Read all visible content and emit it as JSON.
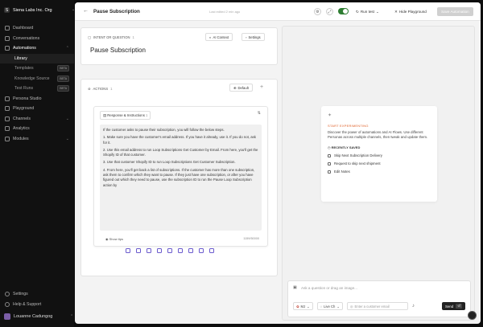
{
  "org": {
    "name": "Siena Labs Inc. Org"
  },
  "sidebar": {
    "items": [
      {
        "label": "Dashboard"
      },
      {
        "label": "Conversations"
      },
      {
        "label": "Automations"
      },
      {
        "label": "Library"
      },
      {
        "label": "Templates",
        "badge": "BETA"
      },
      {
        "label": "Knowledge Source",
        "badge": "BETA"
      },
      {
        "label": "Test Runs",
        "badge": "BETA"
      },
      {
        "label": "Persona Studio"
      },
      {
        "label": "Playground"
      },
      {
        "label": "Channels"
      },
      {
        "label": "Analytics"
      },
      {
        "label": "Modules"
      }
    ],
    "bottom": [
      {
        "label": "Settings"
      },
      {
        "label": "Help & Support"
      }
    ],
    "user": "Louanne Cadungog"
  },
  "header": {
    "title": "Pause Subscription",
    "edited": "Last edited 2 min ago",
    "run_test": "Run test",
    "hide_playground": "Hide Playground",
    "save": "Save Automation"
  },
  "intent": {
    "label": "INTENT OR QUESTION",
    "count": "1",
    "ai_context": "AI Context",
    "settings": "Settings",
    "title": "Pause Subscription"
  },
  "actions": {
    "label": "ACTIONS",
    "count": "1",
    "default": "Default",
    "card_title": "Response & Instructions",
    "card_count": "1",
    "body": [
      "If the customer asks to pause their subscription, you will follow the below steps.",
      "1. Make sure you have the customer's email address. If you have it already, use it. If you do not, ask for it.",
      "2. Use this email address to run Loop Subscriptions Get Customer by Email. From here, you'll get the Shopify ID of that customer.",
      "3. Use that customer Shopify ID to run Loop Subscriptions Get Customer Subscription.",
      "4. From here, you'll get back a list of subscriptions. If the customer has more than one subscription, ask them to confirm which they want to pause. If they just have one subscription, or after you have figured out which they need to pause, use the subscription ID to run the Pause Loop Subscription action by"
    ],
    "show_tips": "Show tips",
    "char_count": "1159/50000"
  },
  "playground": {
    "heading": "START EXPERIMENTING",
    "description": "Discover the power of automations and AI Flows. Use different Personas across multiple channels, then tweak and update them.",
    "recently_saved": "RECENTLY SAVED",
    "recent": [
      "Skip Next Subscription Delivery",
      "Request to skip next shipment",
      "Edit Notes"
    ]
  },
  "chat": {
    "placeholder": "Ask a question or drag an image...",
    "persona": "MJ",
    "channel": "Live Ch",
    "email_placeholder": "Enter a customer email",
    "send": "Send"
  }
}
